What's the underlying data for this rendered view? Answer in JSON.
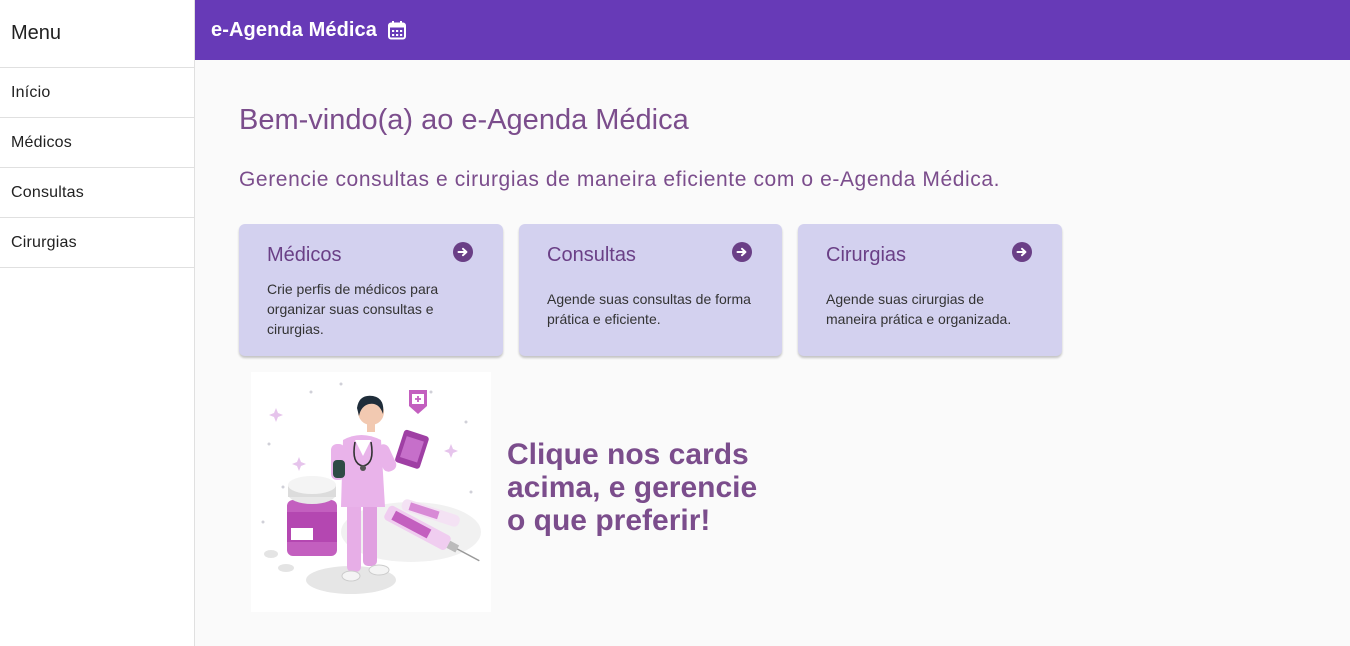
{
  "sidebar": {
    "title": "Menu",
    "items": [
      {
        "label": "Início"
      },
      {
        "label": "Médicos"
      },
      {
        "label": "Consultas"
      },
      {
        "label": "Cirurgias"
      }
    ]
  },
  "header": {
    "title": "e-Agenda Médica",
    "icon": "calendar-icon",
    "color": "#673ab7"
  },
  "main": {
    "welcome": "Bem-vindo(a) ao e-Agenda Médica",
    "subtitle": "Gerencie consultas e cirurgias de maneira eficiente com o e-Agenda Médica.",
    "cards": [
      {
        "title": "Médicos",
        "description": "Crie perfis de médicos para organizar suas consultas e cirurgias.",
        "icon": "arrow-right-circle-icon"
      },
      {
        "title": "Consultas",
        "description": "Agende suas consultas de forma prática e eficiente.",
        "icon": "arrow-right-circle-icon"
      },
      {
        "title": "Cirurgias",
        "description": "Agende suas cirurgias de maneira prática e organizada.",
        "icon": "arrow-right-circle-icon"
      }
    ],
    "cta": "Clique nos cards acima, e gerencie o que preferir!",
    "card_color": "#d3d1ef",
    "accent_color": "#7b4d8c"
  }
}
